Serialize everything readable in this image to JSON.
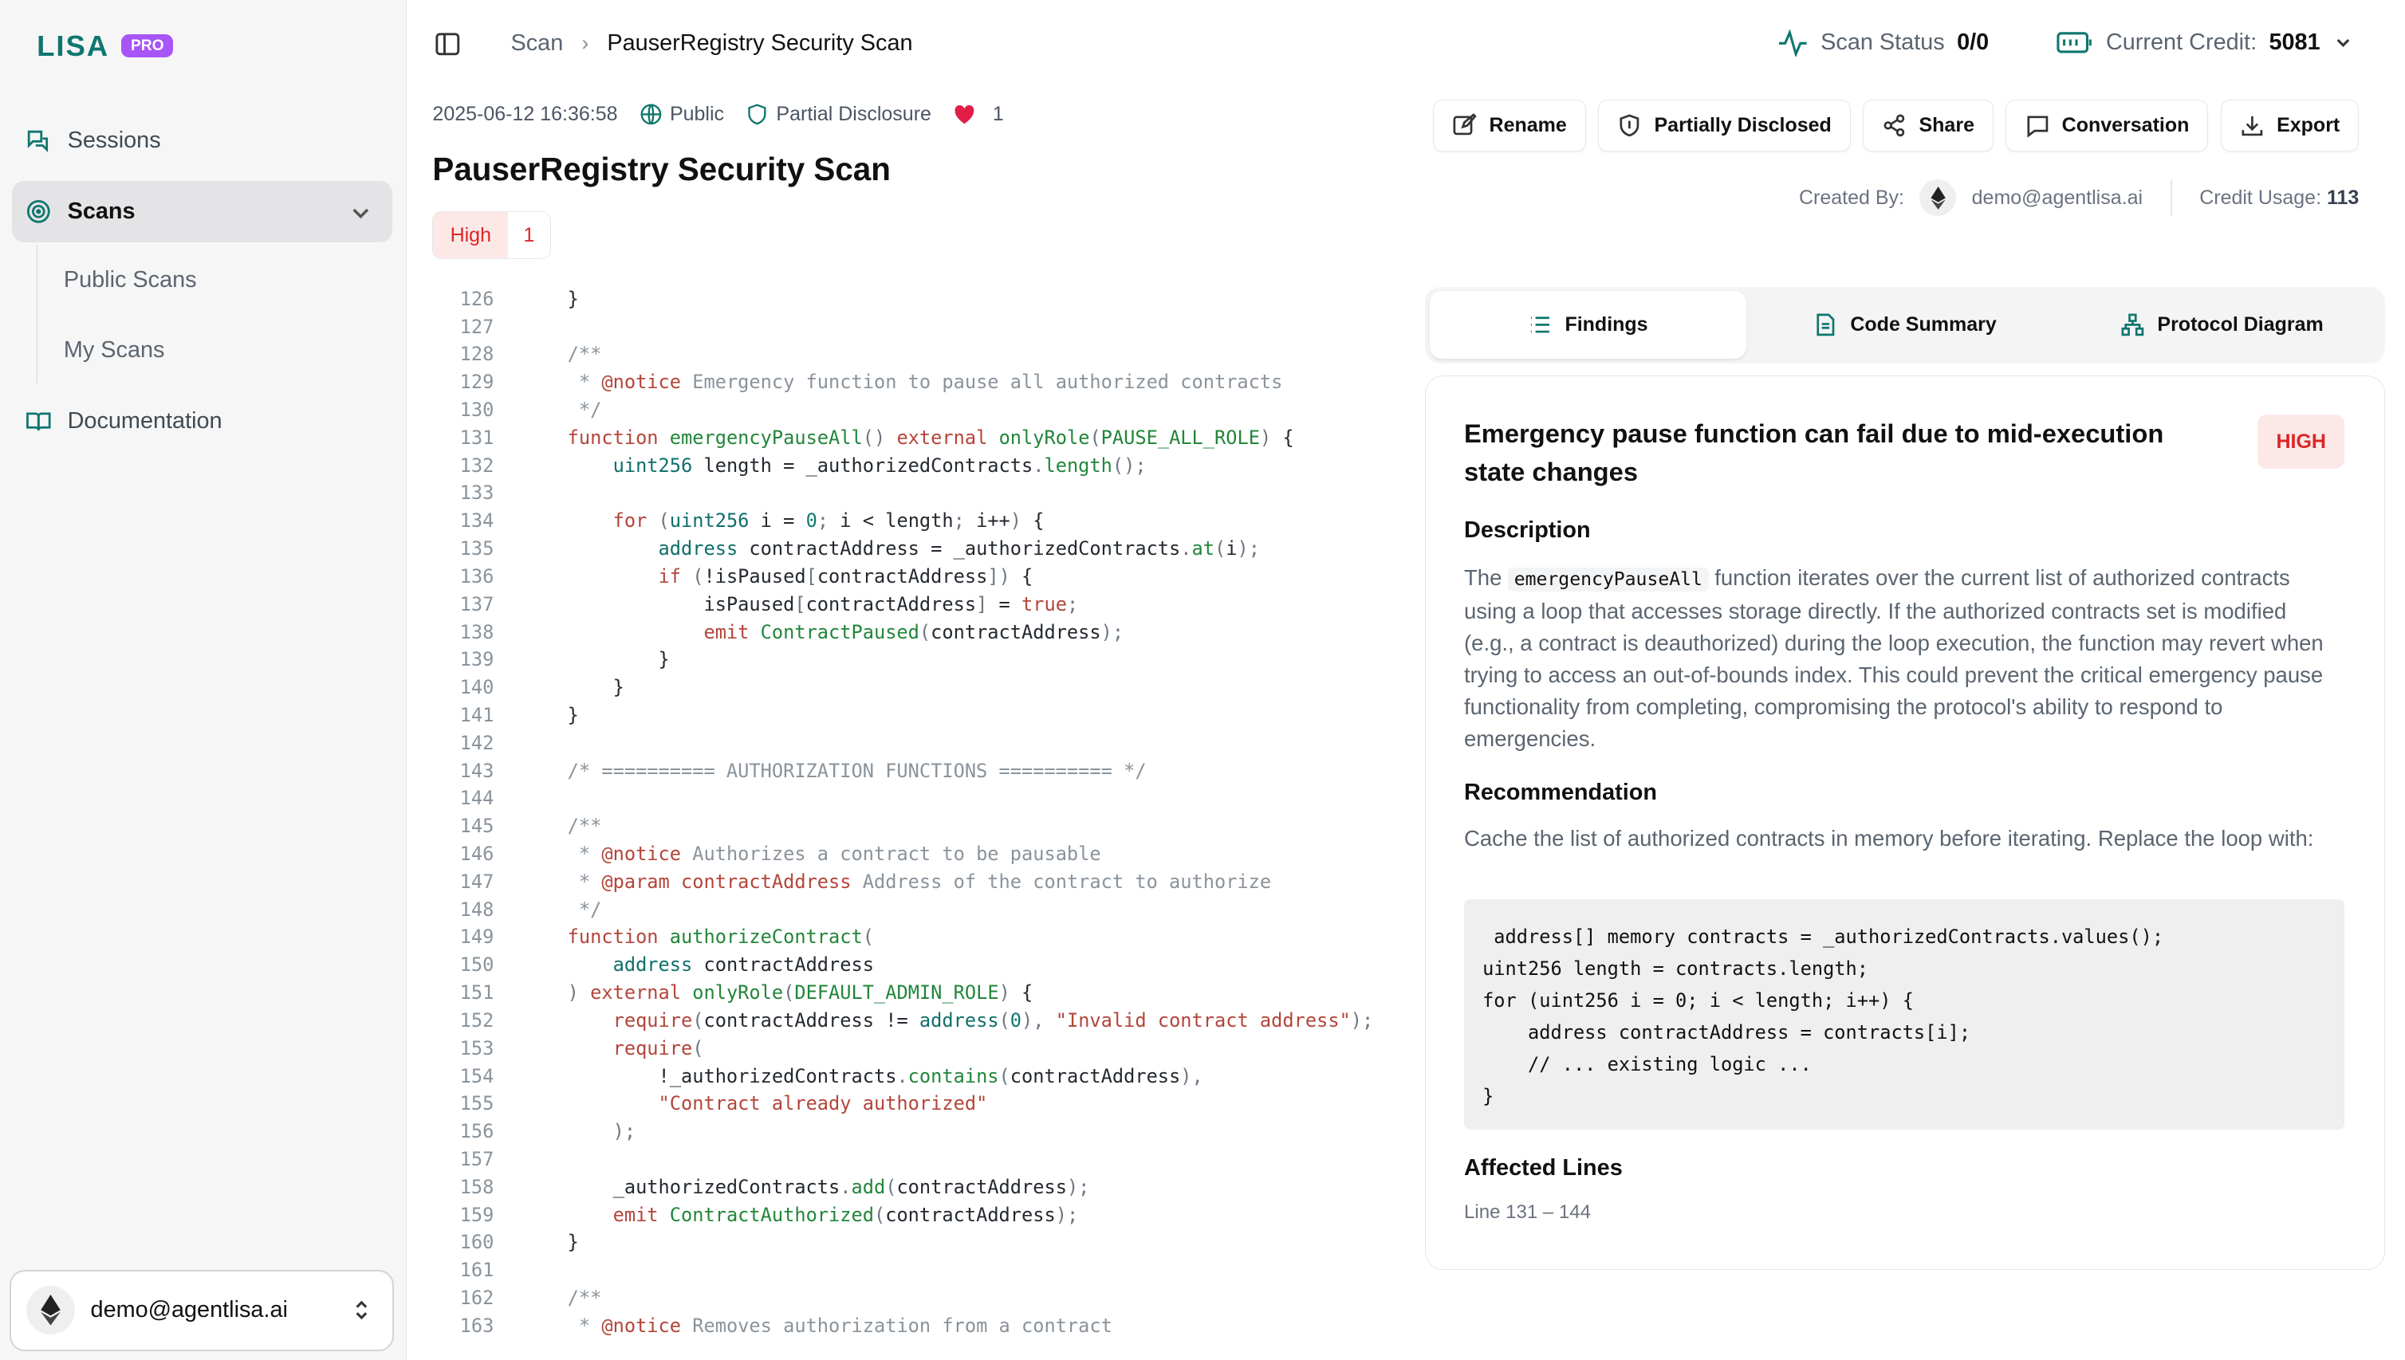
{
  "brand": {
    "name": "LISA",
    "badge": "PRO"
  },
  "sidebar": {
    "items": [
      {
        "label": "Sessions",
        "icon": "chat-bubbles-icon"
      },
      {
        "label": "Scans",
        "icon": "radar-icon"
      },
      {
        "label": "Documentation",
        "icon": "book-icon"
      }
    ],
    "sub_items": [
      {
        "label": "Public Scans"
      },
      {
        "label": "My Scans"
      }
    ],
    "user": {
      "email": "demo@agentlisa.ai"
    }
  },
  "header": {
    "breadcrumb": [
      "Scan",
      "PauserRegistry Security Scan"
    ],
    "scan_status_label": "Scan Status",
    "scan_status_value": "0/0",
    "credit_label": "Current Credit:",
    "credit_value": "5081"
  },
  "meta": {
    "timestamp": "2025-06-12 16:36:58",
    "visibility": "Public",
    "disclosure": "Partial Disclosure",
    "likes": "1"
  },
  "page": {
    "title": "PauserRegistry Security Scan",
    "severity_label": "High",
    "severity_count": "1"
  },
  "actions": [
    "Rename",
    "Partially Disclosed",
    "Share",
    "Conversation",
    "Export"
  ],
  "created": {
    "label": "Created By:",
    "email": "demo@agentlisa.ai",
    "usage_label": "Credit Usage:",
    "usage_value": "113"
  },
  "tabs": [
    "Findings",
    "Code Summary",
    "Protocol Diagram"
  ],
  "finding": {
    "title": "Emergency pause function can fail due to mid-execution state changes",
    "severity": "HIGH",
    "description_heading": "Description",
    "description_pre": "The",
    "description_code": "emergencyPauseAll",
    "description_post": "function iterates over the current list of authorized contracts using a loop that accesses storage directly. If the authorized contracts set is modified (e.g., a contract is deauthorized) during the loop execution, the function may revert when trying to access an out-of-bounds index. This could prevent the critical emergency pause functionality from completing, compromising the protocol's ability to respond to emergencies.",
    "recommendation_heading": "Recommendation",
    "recommendation_text": "Cache the list of authorized contracts in memory before iterating. Replace the loop with:",
    "recommendation_code": " address[] memory contracts = _authorizedContracts.values();\nuint256 length = contracts.length;\nfor (uint256 i = 0; i < length; i++) {\n    address contractAddress = contracts[i];\n    // ... existing logic ...\n}",
    "affected_heading": "Affected Lines",
    "affected_lines": "Line 131 – 144"
  },
  "code_lines": [
    {
      "n": "126",
      "t": "}"
    },
    {
      "n": "127",
      "t": ""
    },
    {
      "n": "128",
      "t": "/**"
    },
    {
      "n": "129",
      "t": " * @notice Emergency function to pause all authorized contracts"
    },
    {
      "n": "130",
      "t": " */"
    },
    {
      "n": "131",
      "t": "function emergencyPauseAll() external onlyRole(PAUSE_ALL_ROLE) {"
    },
    {
      "n": "132",
      "t": "    uint256 length = _authorizedContracts.length();"
    },
    {
      "n": "133",
      "t": ""
    },
    {
      "n": "134",
      "t": "    for (uint256 i = 0; i < length; i++) {"
    },
    {
      "n": "135",
      "t": "        address contractAddress = _authorizedContracts.at(i);"
    },
    {
      "n": "136",
      "t": "        if (!isPaused[contractAddress]) {"
    },
    {
      "n": "137",
      "t": "            isPaused[contractAddress] = true;"
    },
    {
      "n": "138",
      "t": "            emit ContractPaused(contractAddress);"
    },
    {
      "n": "139",
      "t": "        }"
    },
    {
      "n": "140",
      "t": "    }"
    },
    {
      "n": "141",
      "t": "}"
    },
    {
      "n": "142",
      "t": ""
    },
    {
      "n": "143",
      "t": "/* ========== AUTHORIZATION FUNCTIONS ========== */"
    },
    {
      "n": "144",
      "t": ""
    },
    {
      "n": "145",
      "t": "/**"
    },
    {
      "n": "146",
      "t": " * @notice Authorizes a contract to be pausable"
    },
    {
      "n": "147",
      "t": " * @param contractAddress Address of the contract to authorize"
    },
    {
      "n": "148",
      "t": " */"
    },
    {
      "n": "149",
      "t": "function authorizeContract("
    },
    {
      "n": "150",
      "t": "    address contractAddress"
    },
    {
      "n": "151",
      "t": ") external onlyRole(DEFAULT_ADMIN_ROLE) {"
    },
    {
      "n": "152",
      "t": "    require(contractAddress != address(0), \"Invalid contract address\");"
    },
    {
      "n": "153",
      "t": "    require("
    },
    {
      "n": "154",
      "t": "        !_authorizedContracts.contains(contractAddress),"
    },
    {
      "n": "155",
      "t": "        \"Contract already authorized\""
    },
    {
      "n": "156",
      "t": "    );"
    },
    {
      "n": "157",
      "t": ""
    },
    {
      "n": "158",
      "t": "    _authorizedContracts.add(contractAddress);"
    },
    {
      "n": "159",
      "t": "    emit ContractAuthorized(contractAddress);"
    },
    {
      "n": "160",
      "t": "}"
    },
    {
      "n": "161",
      "t": ""
    },
    {
      "n": "162",
      "t": "/**"
    },
    {
      "n": "163",
      "t": " * @notice Removes authorization from a contract"
    }
  ],
  "colors": {
    "brand": "#0f766e",
    "pro_badge": "#a855f7",
    "high": "#dc2626",
    "high_bg": "#fde8e8",
    "heart": "#e11d48"
  }
}
